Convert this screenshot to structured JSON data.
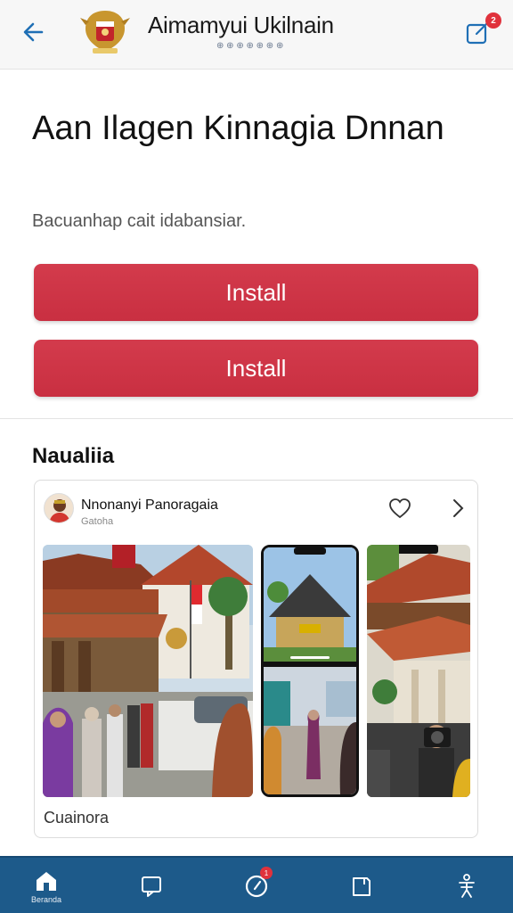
{
  "header": {
    "title": "Aimamyui Ukilnain",
    "subtitle": "⊕ ⊕ ⊕ ⊕ ⊕ ⊕ ⊕",
    "icons": {
      "back": "arrow-left-icon",
      "emblem": "national-emblem-logo",
      "share": "share-icon"
    },
    "notification_count": "2"
  },
  "hero": {
    "headline": "Aan Ilagen Kinnagia Dnnan",
    "subtitle": "Bacuanhap cait idabansiar.",
    "buttons": [
      "Install",
      "Install"
    ]
  },
  "section": {
    "title": "Naualiia"
  },
  "card": {
    "name": "Nnonanyi Panoragaia",
    "meta": "Gatoha",
    "caption": "Cuainora",
    "icons": {
      "like": "heart-icon",
      "next": "chevron-right-icon"
    }
  },
  "navbar": {
    "items": [
      {
        "icon": "home-icon",
        "label": "Beranda"
      },
      {
        "icon": "chat-icon",
        "label": ""
      },
      {
        "icon": "compass-icon",
        "label": "",
        "badge": "1"
      },
      {
        "icon": "book-icon",
        "label": ""
      },
      {
        "icon": "accessibility-icon",
        "label": ""
      }
    ]
  },
  "colors": {
    "accent_red": "#c92f41",
    "nav_blue": "#1d5a8a",
    "back_arrow_blue": "#1f6fb5"
  }
}
